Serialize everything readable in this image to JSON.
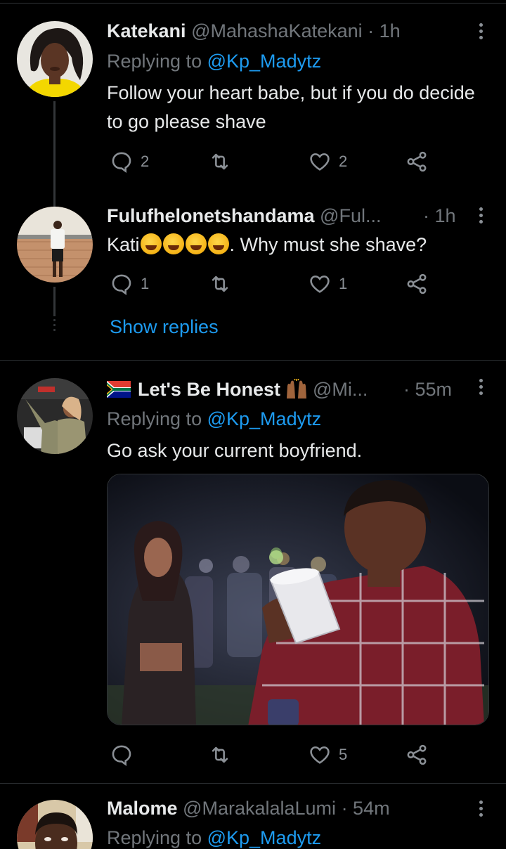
{
  "tweets": [
    {
      "name": "Katekani",
      "handle": "@MahashaKatekani",
      "time": "· 1h",
      "replying_label": "Replying to",
      "replying_to": "@Kp_Madytz",
      "text": "Follow your heart babe, but if you do decide to go please shave",
      "replies": "2",
      "retweets": "",
      "likes": "2"
    },
    {
      "name": "Fulufhelonetshandama",
      "handle": "@Ful...",
      "time": "· 1h",
      "text_prefix": "Kati",
      "text_suffix": ". Why must she shave?",
      "emoji_count": 4,
      "replies": "1",
      "retweets": "",
      "likes": "1",
      "show_replies": "Show replies"
    },
    {
      "name": "Let's Be Honest",
      "handle": "@Mi...",
      "time": "· 55m",
      "replying_label": "Replying to",
      "replying_to": "@Kp_Madytz",
      "text": "Go ask your current boyfriend.",
      "replies": "",
      "retweets": "",
      "likes": "5"
    },
    {
      "name": "Malome",
      "handle": "@MarakalalaLumi",
      "time": "· 54m",
      "replying_label": "Replying to",
      "replying_to": "@Kp_Madytz"
    }
  ],
  "icons": {
    "reply": "reply-icon",
    "retweet": "retweet-icon",
    "like": "heart-icon",
    "share": "share-icon",
    "more": "more-icon"
  },
  "colors": {
    "background": "#000000",
    "text": "#e7e9ea",
    "muted": "#71767b",
    "link": "#1d9bf0",
    "divider": "#2f3336"
  }
}
